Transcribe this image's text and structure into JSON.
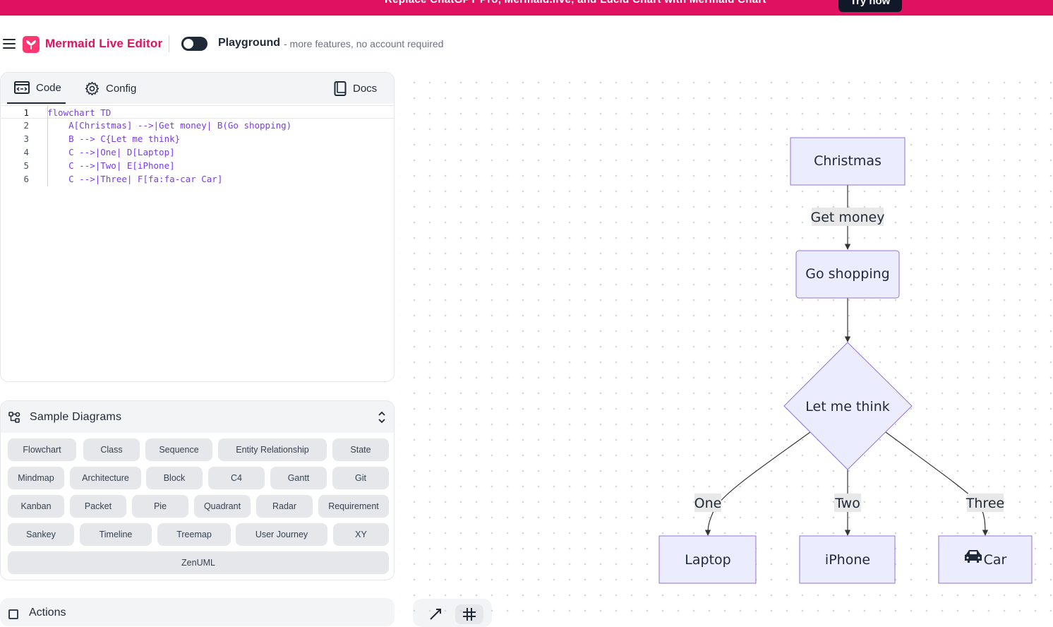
{
  "banner": {
    "text": "Replace ChatGPT Pro, Mermaid.live, and Lucid Chart with Mermaid Chart",
    "button": "Try now"
  },
  "header": {
    "app_title": "Mermaid Live Editor",
    "playground_title": "Playground",
    "playground_subtitle": "- more features, no account required"
  },
  "editor": {
    "tabs": {
      "code": "Code",
      "config": "Config",
      "docs": "Docs"
    },
    "lines": [
      {
        "n": "1",
        "text": "flowchart TD"
      },
      {
        "n": "2",
        "text": "    A[Christmas] -->|Get money| B(Go shopping)"
      },
      {
        "n": "3",
        "text": "    B --> C{Let me think}"
      },
      {
        "n": "4",
        "text": "    C -->|One| D[Laptop]"
      },
      {
        "n": "5",
        "text": "    C -->|Two| E[iPhone]"
      },
      {
        "n": "6",
        "text": "    C -->|Three| F[fa:fa-car Car]"
      }
    ]
  },
  "samples": {
    "title": "Sample Diagrams",
    "buttons": [
      "Flowchart",
      "Class",
      "Sequence",
      "Entity Relationship",
      "State",
      "Mindmap",
      "Architecture",
      "Block",
      "C4",
      "Gantt",
      "Git",
      "Kanban",
      "Packet",
      "Pie",
      "Quadrant",
      "Radar",
      "Requirement",
      "Sankey",
      "Timeline",
      "Treemap",
      "User Journey",
      "XY",
      "ZenUML"
    ]
  },
  "actions": {
    "title": "Actions"
  },
  "diagram": {
    "nodes": {
      "a": "Christmas",
      "b": "Go shopping",
      "c": "Let me think",
      "d": "Laptop",
      "e": "iPhone",
      "f": "Car"
    },
    "edges": {
      "ab": "Get money",
      "cd": "One",
      "ce": "Two",
      "cf": "Three"
    },
    "colors": {
      "node_fill": "#ececff",
      "node_stroke": "#9370db",
      "edge": "#333333"
    },
    "icons": {
      "f": "car-icon"
    }
  }
}
